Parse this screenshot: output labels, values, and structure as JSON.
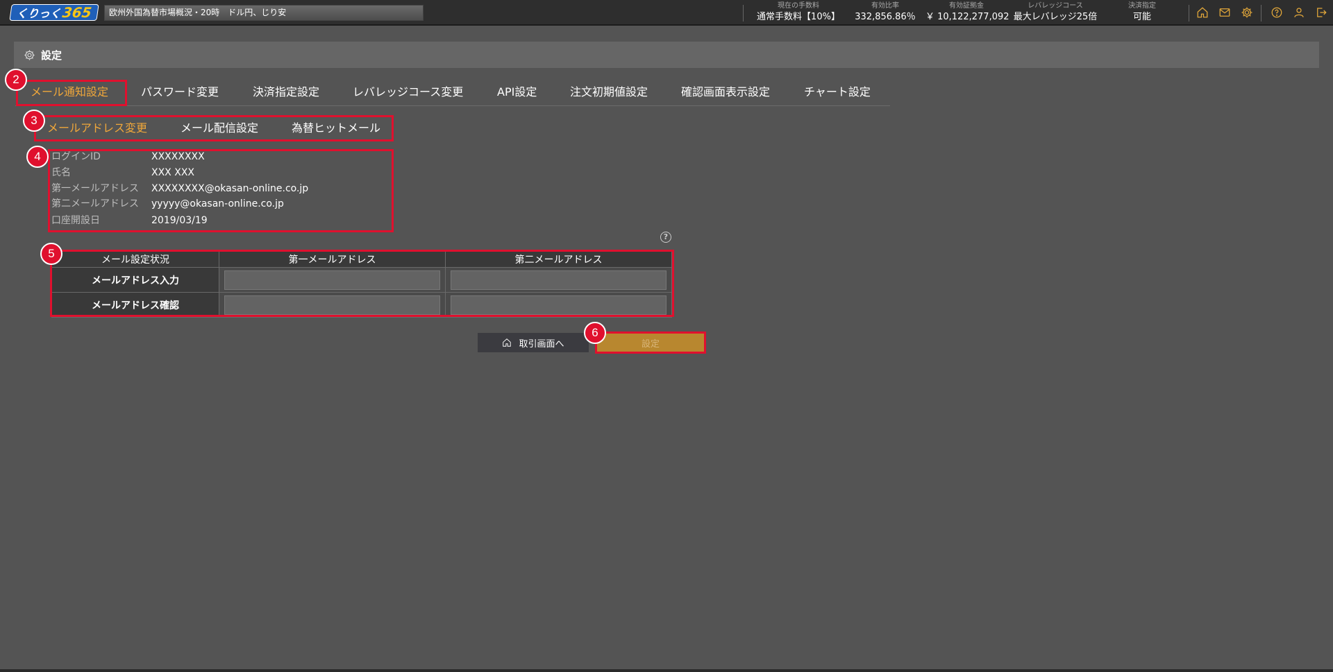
{
  "header": {
    "logo_text": "くりっく",
    "logo_num": "365",
    "ticker": "欧州外国為替市場概況・20時　ドル円、じり安",
    "stats": [
      {
        "label": "現在の手数料",
        "value": "通常手数料【10%】"
      },
      {
        "label": "有効比率",
        "value": "332,856.86％"
      },
      {
        "label": "有効証拠金",
        "value": "￥ 10,122,277,092"
      },
      {
        "label": "レバレッジコース",
        "value": "最大レバレッジ25倍"
      },
      {
        "label": "決済指定",
        "value": "可能"
      }
    ],
    "icons": [
      "home-icon",
      "mail-icon",
      "gear-icon",
      "help-icon",
      "user-icon",
      "logout-icon"
    ]
  },
  "page": {
    "title": "設定"
  },
  "tabs": [
    "メール通知設定",
    "パスワード変更",
    "決済指定設定",
    "レバレッジコース変更",
    "API設定",
    "注文初期値設定",
    "確認画面表示設定",
    "チャート設定"
  ],
  "subtabs": [
    "メールアドレス変更",
    "メール配信設定",
    "為替ヒットメール"
  ],
  "info": [
    {
      "key": "ログインID",
      "value": "XXXXXXXX"
    },
    {
      "key": "氏名",
      "value": "XXX XXX"
    },
    {
      "key": "第一メールアドレス",
      "value": "XXXXXXXX@okasan-online.co.jp"
    },
    {
      "key": "第二メールアドレス",
      "value": "yyyyy@okasan-online.co.jp"
    },
    {
      "key": "口座開設日",
      "value": "2019/03/19"
    }
  ],
  "table": {
    "headers": [
      "メール設定状況",
      "第一メールアドレス",
      "第二メールアドレス"
    ],
    "rows": [
      {
        "label": "メールアドレス入力",
        "values": [
          "",
          ""
        ]
      },
      {
        "label": "メールアドレス確認",
        "values": [
          "",
          ""
        ]
      }
    ]
  },
  "buttons": {
    "back": "取引画面へ",
    "set": "設定"
  },
  "badges": [
    "2",
    "3",
    "4",
    "5",
    "6"
  ],
  "colors": {
    "accent": "#f0a73a",
    "annotation": "#e0102e",
    "set_button": "#b8872f"
  }
}
